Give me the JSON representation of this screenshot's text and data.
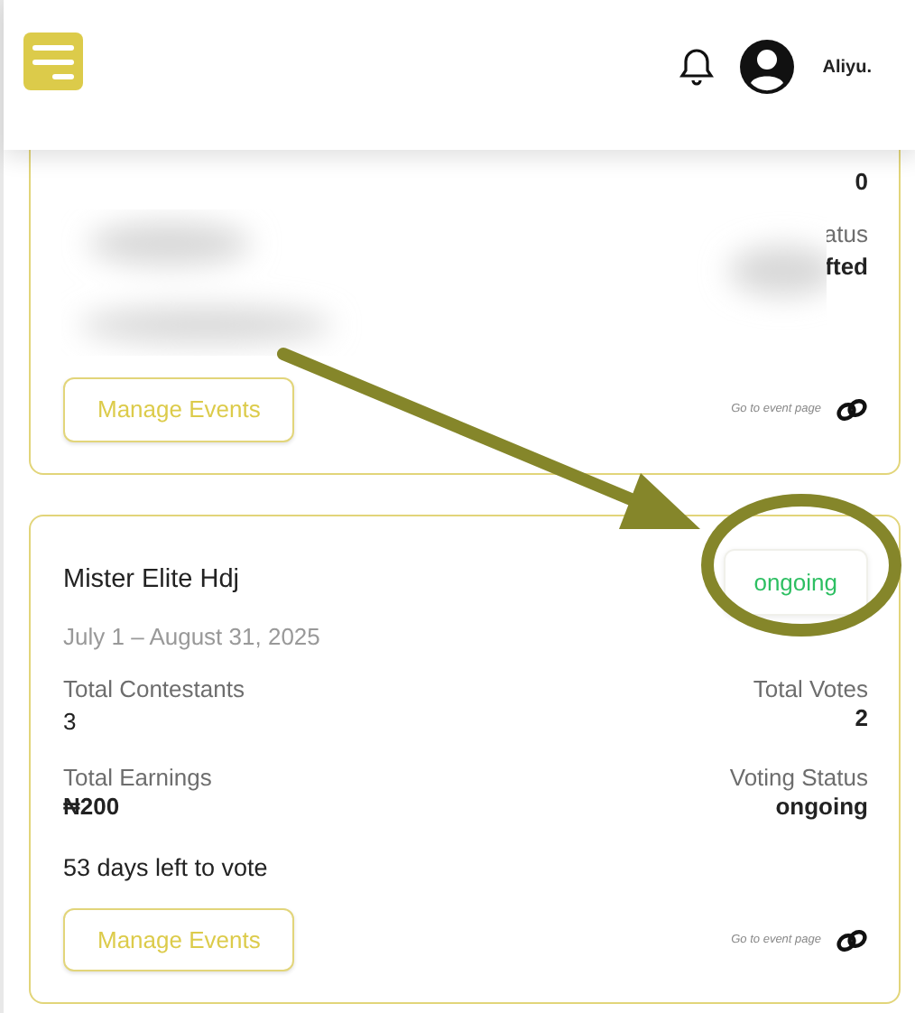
{
  "header": {
    "username": "Aliyu."
  },
  "events": [
    {
      "kind": "redacted",
      "votes": "0",
      "status_label_part": "atus",
      "status_value_part": "fted",
      "manage_label": "Manage Events",
      "link_label": "Go to event page"
    },
    {
      "kind": "full",
      "title": "Mister Elite Hdj",
      "status_badge": "ongoing",
      "dates": "July 1 – August 31, 2025",
      "stats": [
        {
          "label": "Total Contestants",
          "value": "3"
        },
        {
          "label": "Total Votes",
          "value": "2"
        },
        {
          "label": "Total Earnings",
          "value": "₦200"
        },
        {
          "label": "Voting Status",
          "value": "ongoing"
        }
      ],
      "days_left": "53 days left to vote",
      "manage_label": "Manage Events",
      "link_label": "Go to event page"
    }
  ]
}
